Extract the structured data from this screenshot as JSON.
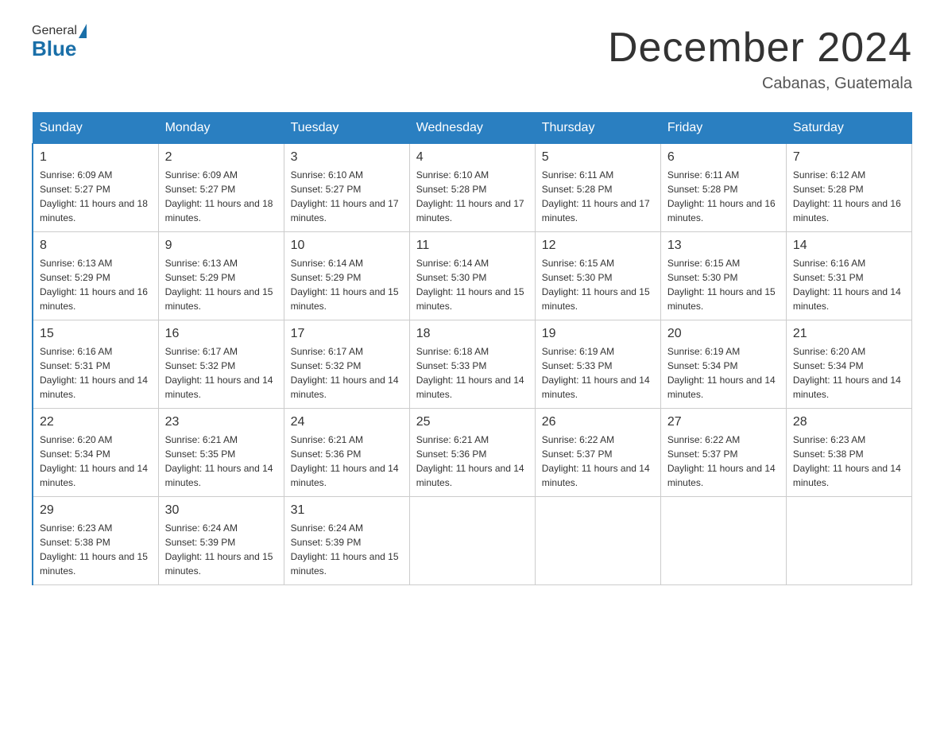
{
  "header": {
    "logo_general": "General",
    "logo_blue": "Blue",
    "month_title": "December 2024",
    "location": "Cabanas, Guatemala"
  },
  "days_of_week": [
    "Sunday",
    "Monday",
    "Tuesday",
    "Wednesday",
    "Thursday",
    "Friday",
    "Saturday"
  ],
  "weeks": [
    [
      {
        "day": "1",
        "sunrise": "6:09 AM",
        "sunset": "5:27 PM",
        "daylight": "11 hours and 18 minutes."
      },
      {
        "day": "2",
        "sunrise": "6:09 AM",
        "sunset": "5:27 PM",
        "daylight": "11 hours and 18 minutes."
      },
      {
        "day": "3",
        "sunrise": "6:10 AM",
        "sunset": "5:27 PM",
        "daylight": "11 hours and 17 minutes."
      },
      {
        "day": "4",
        "sunrise": "6:10 AM",
        "sunset": "5:28 PM",
        "daylight": "11 hours and 17 minutes."
      },
      {
        "day": "5",
        "sunrise": "6:11 AM",
        "sunset": "5:28 PM",
        "daylight": "11 hours and 17 minutes."
      },
      {
        "day": "6",
        "sunrise": "6:11 AM",
        "sunset": "5:28 PM",
        "daylight": "11 hours and 16 minutes."
      },
      {
        "day": "7",
        "sunrise": "6:12 AM",
        "sunset": "5:28 PM",
        "daylight": "11 hours and 16 minutes."
      }
    ],
    [
      {
        "day": "8",
        "sunrise": "6:13 AM",
        "sunset": "5:29 PM",
        "daylight": "11 hours and 16 minutes."
      },
      {
        "day": "9",
        "sunrise": "6:13 AM",
        "sunset": "5:29 PM",
        "daylight": "11 hours and 15 minutes."
      },
      {
        "day": "10",
        "sunrise": "6:14 AM",
        "sunset": "5:29 PM",
        "daylight": "11 hours and 15 minutes."
      },
      {
        "day": "11",
        "sunrise": "6:14 AM",
        "sunset": "5:30 PM",
        "daylight": "11 hours and 15 minutes."
      },
      {
        "day": "12",
        "sunrise": "6:15 AM",
        "sunset": "5:30 PM",
        "daylight": "11 hours and 15 minutes."
      },
      {
        "day": "13",
        "sunrise": "6:15 AM",
        "sunset": "5:30 PM",
        "daylight": "11 hours and 15 minutes."
      },
      {
        "day": "14",
        "sunrise": "6:16 AM",
        "sunset": "5:31 PM",
        "daylight": "11 hours and 14 minutes."
      }
    ],
    [
      {
        "day": "15",
        "sunrise": "6:16 AM",
        "sunset": "5:31 PM",
        "daylight": "11 hours and 14 minutes."
      },
      {
        "day": "16",
        "sunrise": "6:17 AM",
        "sunset": "5:32 PM",
        "daylight": "11 hours and 14 minutes."
      },
      {
        "day": "17",
        "sunrise": "6:17 AM",
        "sunset": "5:32 PM",
        "daylight": "11 hours and 14 minutes."
      },
      {
        "day": "18",
        "sunrise": "6:18 AM",
        "sunset": "5:33 PM",
        "daylight": "11 hours and 14 minutes."
      },
      {
        "day": "19",
        "sunrise": "6:19 AM",
        "sunset": "5:33 PM",
        "daylight": "11 hours and 14 minutes."
      },
      {
        "day": "20",
        "sunrise": "6:19 AM",
        "sunset": "5:34 PM",
        "daylight": "11 hours and 14 minutes."
      },
      {
        "day": "21",
        "sunrise": "6:20 AM",
        "sunset": "5:34 PM",
        "daylight": "11 hours and 14 minutes."
      }
    ],
    [
      {
        "day": "22",
        "sunrise": "6:20 AM",
        "sunset": "5:34 PM",
        "daylight": "11 hours and 14 minutes."
      },
      {
        "day": "23",
        "sunrise": "6:21 AM",
        "sunset": "5:35 PM",
        "daylight": "11 hours and 14 minutes."
      },
      {
        "day": "24",
        "sunrise": "6:21 AM",
        "sunset": "5:36 PM",
        "daylight": "11 hours and 14 minutes."
      },
      {
        "day": "25",
        "sunrise": "6:21 AM",
        "sunset": "5:36 PM",
        "daylight": "11 hours and 14 minutes."
      },
      {
        "day": "26",
        "sunrise": "6:22 AM",
        "sunset": "5:37 PM",
        "daylight": "11 hours and 14 minutes."
      },
      {
        "day": "27",
        "sunrise": "6:22 AM",
        "sunset": "5:37 PM",
        "daylight": "11 hours and 14 minutes."
      },
      {
        "day": "28",
        "sunrise": "6:23 AM",
        "sunset": "5:38 PM",
        "daylight": "11 hours and 14 minutes."
      }
    ],
    [
      {
        "day": "29",
        "sunrise": "6:23 AM",
        "sunset": "5:38 PM",
        "daylight": "11 hours and 15 minutes."
      },
      {
        "day": "30",
        "sunrise": "6:24 AM",
        "sunset": "5:39 PM",
        "daylight": "11 hours and 15 minutes."
      },
      {
        "day": "31",
        "sunrise": "6:24 AM",
        "sunset": "5:39 PM",
        "daylight": "11 hours and 15 minutes."
      },
      null,
      null,
      null,
      null
    ]
  ],
  "labels": {
    "sunrise_prefix": "Sunrise: ",
    "sunset_prefix": "Sunset: ",
    "daylight_prefix": "Daylight: "
  }
}
